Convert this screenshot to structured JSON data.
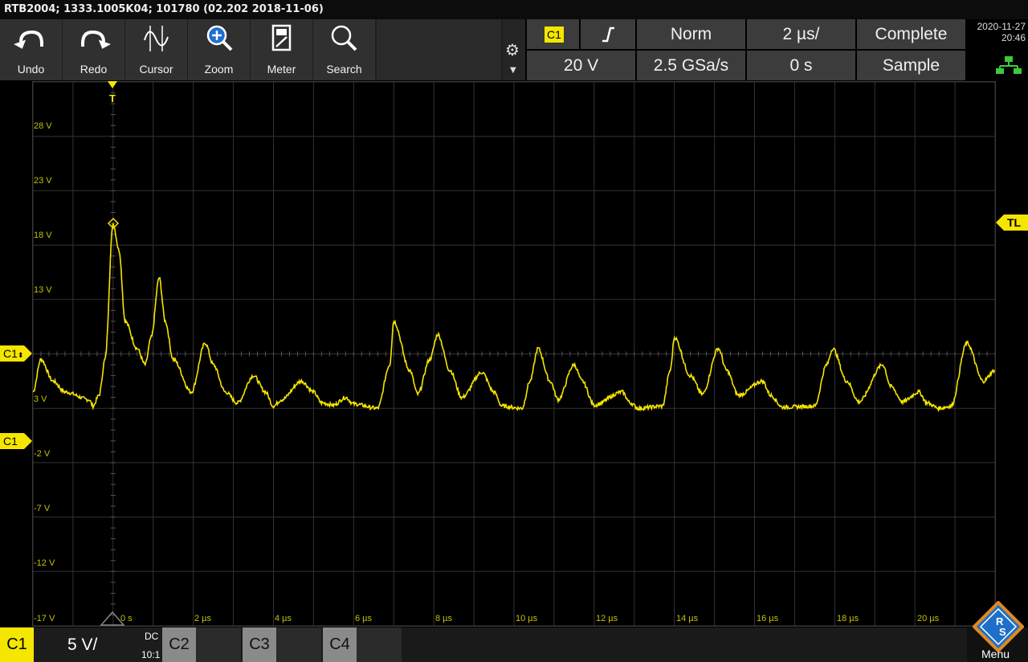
{
  "title": "RTB2004; 1333.1005K04; 101780 (02.202 2018-11-06)",
  "toolbar": {
    "undo": "Undo",
    "redo": "Redo",
    "cursor": "Cursor",
    "zoom": "Zoom",
    "meter": "Meter",
    "search": "Search"
  },
  "settings_icon": "gear-icon",
  "trigger": {
    "source": "C1",
    "slope": "rising-edge-icon",
    "mode": "Norm",
    "level": "20 V"
  },
  "acquisition": {
    "timebase": "2 µs/",
    "sample_rate": "2.5 GSa/s",
    "state": "Complete",
    "position": "0 s",
    "mode": "Sample"
  },
  "datetime": {
    "date": "2020-11-27",
    "time": "20:46"
  },
  "y_labels": [
    "28 V",
    "23 V",
    "18 V",
    "13 V",
    "C1",
    "3 V",
    "-2 V",
    "-7 V",
    "-12 V",
    "-17 V"
  ],
  "x_labels": [
    "0 s",
    "2 µs",
    "4 µs",
    "6 µs",
    "8 µs",
    "10 µs",
    "12 µs",
    "14 µs",
    "16 µs",
    "18 µs",
    "20 µs"
  ],
  "markers": {
    "trigger_top": "T",
    "c1_offset": "C1",
    "c1_ground": "C1",
    "trigger_level": "TL"
  },
  "channels": {
    "c1": {
      "label": "C1",
      "scale": "5 V/",
      "coupling": "DC",
      "probe": "10:1"
    },
    "c2": {
      "label": "C2"
    },
    "c3": {
      "label": "C3"
    },
    "c4": {
      "label": "C4"
    }
  },
  "menu": "Menu",
  "colors": {
    "trace": "#f5e600",
    "grid": "#333333",
    "label": "#c8c000"
  },
  "chart_data": {
    "type": "line",
    "xlabel": "",
    "ylabel": "",
    "xlim": [
      -2,
      22
    ],
    "ylim": [
      -17,
      33
    ],
    "series": [
      {
        "points": [
          [
            -2.0,
            4.5
          ],
          [
            -1.8,
            7.5
          ],
          [
            -1.5,
            5.5
          ],
          [
            -1.2,
            4.5
          ],
          [
            -0.6,
            3.8
          ],
          [
            -0.5,
            3.2
          ],
          [
            -0.35,
            4.2
          ],
          [
            -0.2,
            7.5
          ],
          [
            0.0,
            20.0
          ],
          [
            0.15,
            17.5
          ],
          [
            0.3,
            11.0
          ],
          [
            0.6,
            8.5
          ],
          [
            0.8,
            7.0
          ],
          [
            0.95,
            9.5
          ],
          [
            1.15,
            15.0
          ],
          [
            1.3,
            11.0
          ],
          [
            1.5,
            7.5
          ],
          [
            1.95,
            4.5
          ],
          [
            2.3,
            9.0
          ],
          [
            2.5,
            7.0
          ],
          [
            2.8,
            4.5
          ],
          [
            3.1,
            3.5
          ],
          [
            3.5,
            6.0
          ],
          [
            3.8,
            4.5
          ],
          [
            4.0,
            3.2
          ],
          [
            4.2,
            3.8
          ],
          [
            4.7,
            5.5
          ],
          [
            5.0,
            4.5
          ],
          [
            5.2,
            3.5
          ],
          [
            5.5,
            3.3
          ],
          [
            5.8,
            4.0
          ],
          [
            6.0,
            3.4
          ],
          [
            6.6,
            3.0
          ],
          [
            6.9,
            7.0
          ],
          [
            7.0,
            11.0
          ],
          [
            7.4,
            6.5
          ],
          [
            7.6,
            4.3
          ],
          [
            7.9,
            7.5
          ],
          [
            8.1,
            9.8
          ],
          [
            8.4,
            6.5
          ],
          [
            8.7,
            4.0
          ],
          [
            9.2,
            6.3
          ],
          [
            9.5,
            4.5
          ],
          [
            9.7,
            3.2
          ],
          [
            10.2,
            3.0
          ],
          [
            10.4,
            5.5
          ],
          [
            10.6,
            8.5
          ],
          [
            10.9,
            5.5
          ],
          [
            11.1,
            3.8
          ],
          [
            11.5,
            7.0
          ],
          [
            11.7,
            5.5
          ],
          [
            12.0,
            3.3
          ],
          [
            12.7,
            4.5
          ],
          [
            12.9,
            3.5
          ],
          [
            13.1,
            3.0
          ],
          [
            13.7,
            3.2
          ],
          [
            13.9,
            6.5
          ],
          [
            14.0,
            9.5
          ],
          [
            14.4,
            6.0
          ],
          [
            14.7,
            4.3
          ],
          [
            15.1,
            8.5
          ],
          [
            15.3,
            6.5
          ],
          [
            15.6,
            4.2
          ],
          [
            16.2,
            5.5
          ],
          [
            16.4,
            4.2
          ],
          [
            16.7,
            3.1
          ],
          [
            17.5,
            3.2
          ],
          [
            17.8,
            7.0
          ],
          [
            17.95,
            8.5
          ],
          [
            18.3,
            5.5
          ],
          [
            18.6,
            3.6
          ],
          [
            19.2,
            7.0
          ],
          [
            19.4,
            5.0
          ],
          [
            19.7,
            3.6
          ],
          [
            20.1,
            4.5
          ],
          [
            20.3,
            3.5
          ],
          [
            20.6,
            3.0
          ],
          [
            20.9,
            3.2
          ],
          [
            21.3,
            9.0
          ],
          [
            21.7,
            5.5
          ],
          [
            22.0,
            6.5
          ]
        ]
      }
    ]
  }
}
